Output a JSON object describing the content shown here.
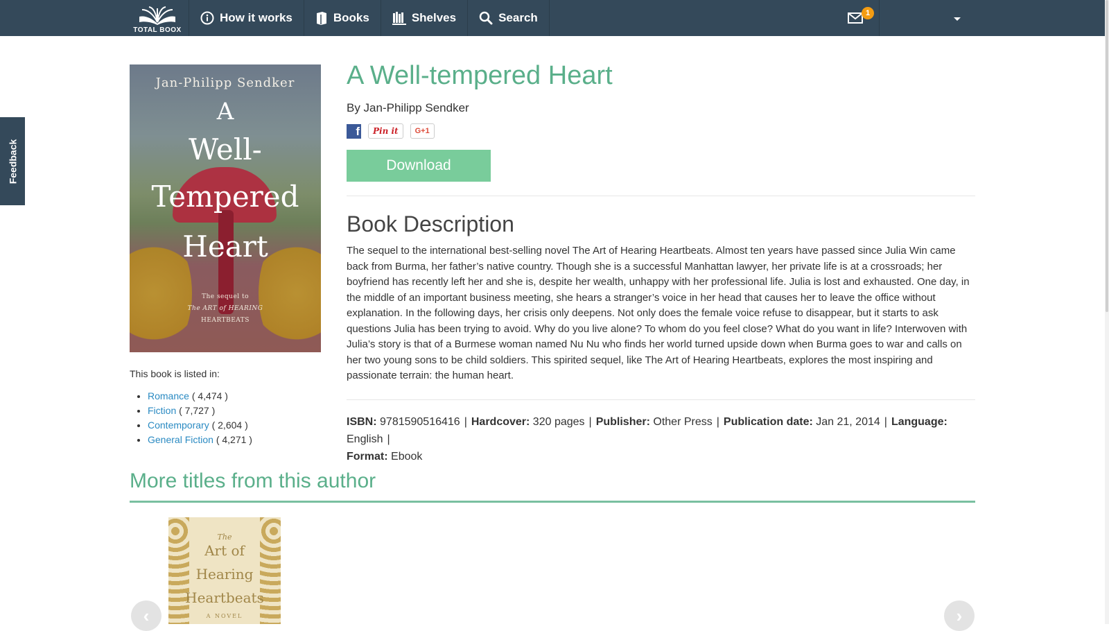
{
  "nav": {
    "logo_text": "TOTAL BOOX",
    "items": [
      {
        "label": "How it works",
        "icon": "info-icon"
      },
      {
        "label": "Books",
        "icon": "book-icon"
      },
      {
        "label": "Shelves",
        "icon": "shelves-icon"
      },
      {
        "label": "Search",
        "icon": "search-icon"
      }
    ],
    "mail_badge": "1"
  },
  "feedback_label": "Feedback",
  "book": {
    "cover": {
      "author": "Jan-Philipp Sendker",
      "title_line1": "A",
      "title_line2": "Well-",
      "title_line3": "Tempered",
      "title_line4": "Heart",
      "tagline1": "The sequel to",
      "tagline2": "The ART of HEARING",
      "tagline3": "HEARTBEATS"
    },
    "title": "A Well-tempered Heart",
    "byline": "By Jan-Philipp Sendker",
    "share": {
      "facebook": "f",
      "pinterest": "Pin it",
      "gplus": "G+1"
    },
    "download_label": "Download",
    "description_heading": "Book Description",
    "description": "The sequel to the international best-selling novel The Art of Hearing Heartbeats. Almost ten years have passed since Julia Win came back from Burma, her father’s native country. Though she is a successful Manhattan lawyer, her private life is at a crossroads; her boyfriend has recently left her and she is, despite her wealth, unhappy with her professional life. Julia is lost and exhausted. One day, in the middle of an important business meeting, she hears a stranger’s voice in her head that causes her to leave the office without explanation. In the following days, her crisis only deepens. Not only does the female voice refuse to disappear, but it starts to ask questions Julia has been trying to avoid. Why do you live alone? To whom do you feel close? What do you want in life? Interwoven with Julia’s story is that of a Burmese woman named Nu Nu who finds her world turned upside down when Burma goes to war and calls on her two young sons to be child soldiers. This spirited sequel, like The Art of Hearing Heartbeats, explores the most inspiring and passionate terrain: the human heart.",
    "meta": {
      "isbn_label": "ISBN:",
      "isbn": "9781590516416",
      "hardcover_label": "Hardcover:",
      "hardcover": "320 pages",
      "publisher_label": "Publisher:",
      "publisher": "Other Press",
      "pubdate_label": "Publication date:",
      "pubdate": "Jan 21, 2014",
      "language_label": "Language:",
      "language": "English",
      "format_label": "Format:",
      "format": "Ebook"
    }
  },
  "listed": {
    "label": "This book is listed in:",
    "items": [
      {
        "name": "Romance",
        "count": "( 4,474 )"
      },
      {
        "name": "Fiction",
        "count": "( 7,727 )"
      },
      {
        "name": "Contemporary",
        "count": "( 2,604 )"
      },
      {
        "name": "General Fiction",
        "count": "( 4,271 )"
      }
    ]
  },
  "more": {
    "heading": "More titles from this author",
    "cover": {
      "line1": "The",
      "line2": "Art of",
      "line3": "Hearing",
      "line4": "Heartbeats",
      "line5": "A NOVEL"
    },
    "prev": "‹",
    "next": "›"
  },
  "colors": {
    "nav_bg": "#34495a",
    "accent_green": "#5aaf8a",
    "button_green": "#79cc9b",
    "link_blue": "#2a8ac2",
    "badge_orange": "#f39c12"
  }
}
